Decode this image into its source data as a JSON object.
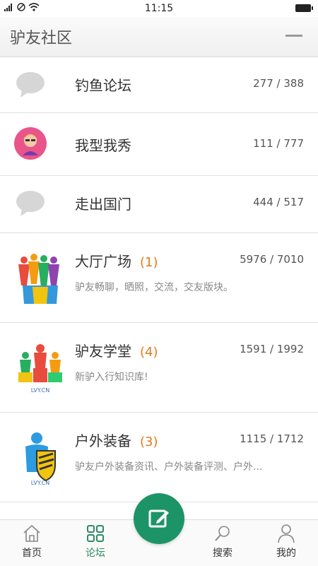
{
  "status_bar": {
    "time": "11:15"
  },
  "header": {
    "title": "驴友社区"
  },
  "forums": [
    {
      "name": "钓鱼论坛",
      "stats": "277 / 388",
      "icon": "chat-bubble-icon"
    },
    {
      "name": "我型我秀",
      "stats": "111 / 777",
      "icon": "avatar-icon"
    },
    {
      "name": "走出国门",
      "stats": "444 / 517",
      "icon": "chat-bubble-icon"
    },
    {
      "name": "大厅广场",
      "new_count": "(1)",
      "stats": "5976 / 7010",
      "desc": "驴友畅聊，晒照，交流，交友版块。",
      "icon": "people-group-icon"
    },
    {
      "name": "驴友学堂",
      "new_count": "(4)",
      "stats": "1591 / 1992",
      "desc": "新驴入行知识库!",
      "icon": "podium-people-icon"
    },
    {
      "name": "户外装备",
      "new_count": "(3)",
      "stats": "1115 / 1712",
      "desc": "驴友户外装备资讯、户外装备评测、户外...",
      "icon": "shield-person-icon"
    }
  ],
  "bottom_nav": {
    "home": "首页",
    "forum": "论坛",
    "search": "搜索",
    "mine": "我的"
  },
  "colors": {
    "accent": "#1d9468",
    "orange": "#e07b1a"
  }
}
